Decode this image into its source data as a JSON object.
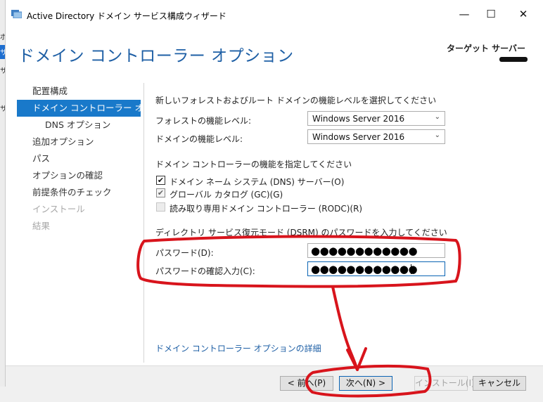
{
  "window": {
    "title": "Active Directory ドメイン サービス構成ウィザード",
    "minimize_glyph": "—",
    "maximize_glyph": "☐",
    "close_glyph": "✕"
  },
  "background": {
    "left_marks": [
      "ポ",
      "サ",
      "サ",
      "サ"
    ]
  },
  "page": {
    "title": "ドメイン コントローラー オプション",
    "target_label": "ターゲット サーバー"
  },
  "nav": {
    "items": [
      {
        "label": "配置構成",
        "state": "normal"
      },
      {
        "label": "ドメイン コントローラー オプシ...",
        "state": "active"
      },
      {
        "label": "DNS オプション",
        "state": "sub"
      },
      {
        "label": "追加オプション",
        "state": "normal"
      },
      {
        "label": "パス",
        "state": "normal"
      },
      {
        "label": "オプションの確認",
        "state": "normal"
      },
      {
        "label": "前提条件のチェック",
        "state": "normal"
      },
      {
        "label": "インストール",
        "state": "disabled"
      },
      {
        "label": "結果",
        "state": "disabled"
      }
    ]
  },
  "form": {
    "functional_level_heading": "新しいフォレストおよびルート ドメインの機能レベルを選択してください",
    "forest_level_label": "フォレストの機能レベル:",
    "forest_level_value": "Windows Server 2016",
    "domain_level_label": "ドメインの機能レベル:",
    "domain_level_value": "Windows Server 2016",
    "capabilities_heading": "ドメイン コントローラーの機能を指定してください",
    "dns_label": "ドメイン ネーム システム (DNS) サーバー(O)",
    "gc_label": "グローバル カタログ (GC)(G)",
    "rodc_label": "読み取り専用ドメイン コントローラー (RODC)(R)",
    "check_glyph": "✔",
    "dsrm_heading": "ディレクトリ サービス復元モード (DSRM) のパスワードを入力してください",
    "password_label": "パスワード(D):",
    "password_value": "●●●●●●●●●●●●",
    "confirm_label": "パスワードの確認入力(C):",
    "confirm_value": "●●●●●●●●●●●●",
    "chevron_glyph": "⌄"
  },
  "links": {
    "more": "ドメイン コントローラー オプションの詳細"
  },
  "footer": {
    "prev": "< 前へ(P)",
    "next": "次へ(N) >",
    "install": "インストール(I)",
    "cancel": "キャンセル"
  },
  "colors": {
    "accent": "#1979ca",
    "title_blue": "#1e5fa5",
    "annotation_red": "#d8141c"
  }
}
